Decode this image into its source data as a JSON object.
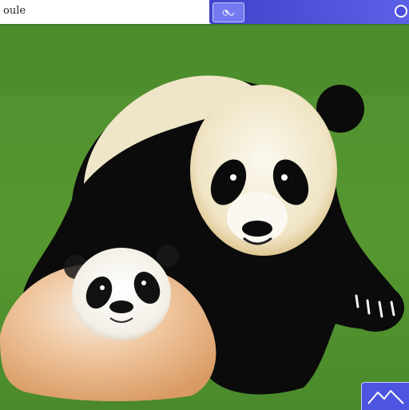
{
  "topbar": {
    "title": "oule"
  },
  "colors": {
    "grass": "#4a8a2c",
    "panel": "#4f53df",
    "panda_black": "#0b0b0b",
    "panda_cream": "#f2ead2"
  }
}
